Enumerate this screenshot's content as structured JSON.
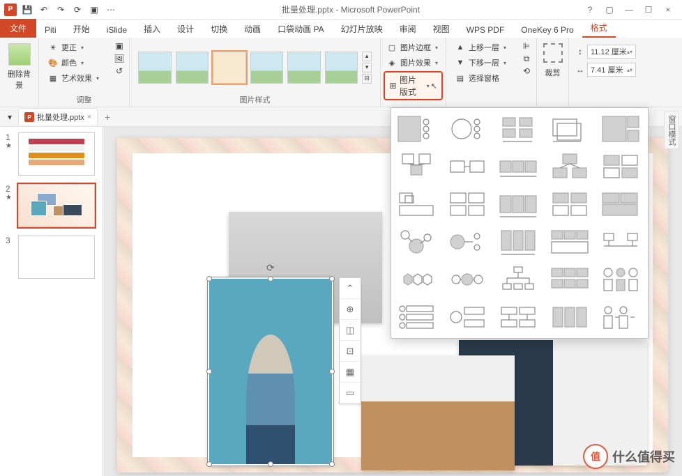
{
  "titlebar": {
    "app_icon": "P",
    "title": "批量处理.pptx - Microsoft PowerPoint",
    "help": "?",
    "ribbon_toggle": "▢",
    "minimize": "—",
    "maximize": "☐",
    "close": "×"
  },
  "tabs": {
    "file": "文件",
    "items": [
      "Piti",
      "开始",
      "iSlide",
      "插入",
      "设计",
      "切换",
      "动画",
      "口袋动画 PA",
      "幻灯片放映",
      "审阅",
      "视图",
      "WPS PDF",
      "OneKey 6 Pro"
    ],
    "active": "格式"
  },
  "ribbon": {
    "remove_bg": "删除背景",
    "adjust": {
      "correct": "更正",
      "color": "颜色",
      "artistic": "艺术效果",
      "label": "调整"
    },
    "styles": {
      "label": "图片样式"
    },
    "effects": {
      "border": "图片边框",
      "fx": "图片效果",
      "layout": "图片版式"
    },
    "arrange": {
      "forward": "上移一层",
      "backward": "下移一层",
      "select_pane": "选择窗格"
    },
    "crop": "裁剪",
    "size": {
      "height": "11.12 厘米",
      "width": "7.41 厘米"
    }
  },
  "doc_tabs": {
    "filename": "批量处理.pptx",
    "close": "×",
    "add": "+"
  },
  "slides": [
    {
      "num": "1",
      "star": "★"
    },
    {
      "num": "2",
      "star": "★"
    },
    {
      "num": "3"
    }
  ],
  "window_mode": "窗口模式",
  "watermark": {
    "icon": "值",
    "text": "什么值得买"
  },
  "float_toolbar": [
    "⌃",
    "⊕",
    "◫",
    "⊡",
    "▦",
    "▭"
  ]
}
